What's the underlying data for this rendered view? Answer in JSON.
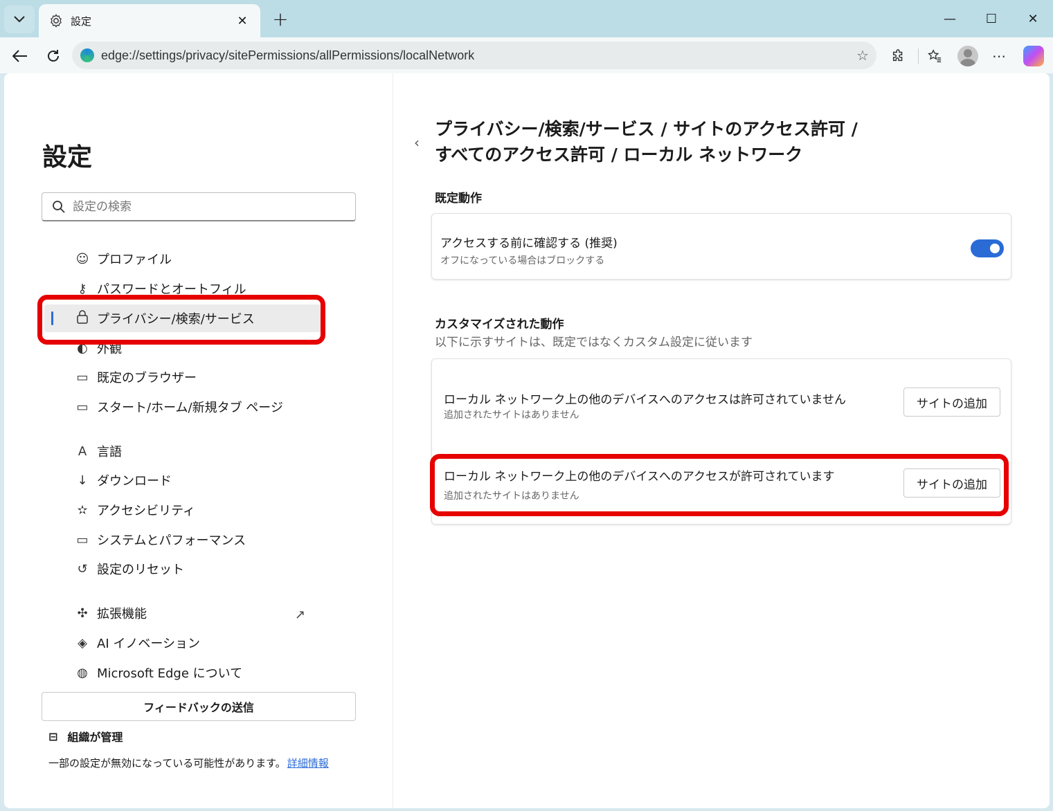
{
  "window": {
    "tab_title": "設定",
    "minimize": "—",
    "maximize": "☐",
    "close": "✕"
  },
  "toolbar": {
    "url": "edge://settings/privacy/sitePermissions/allPermissions/localNetwork"
  },
  "sidebar": {
    "title": "設定",
    "search_placeholder": "設定の検索",
    "items": [
      {
        "label": "プロファイル",
        "icon": "profile-icon"
      },
      {
        "label": "パスワードとオートフィル",
        "icon": "key-icon"
      },
      {
        "label": "プライバシー/検索/サービス",
        "icon": "lock-icon",
        "active": true
      },
      {
        "label": "外観",
        "icon": "palette-icon"
      },
      {
        "label": "既定のブラウザー",
        "icon": "browser-icon"
      },
      {
        "label": "スタート/ホーム/新規タブ ページ",
        "icon": "home-page-icon"
      },
      {
        "label": "言語",
        "icon": "language-icon"
      },
      {
        "label": "ダウンロード",
        "icon": "download-icon"
      },
      {
        "label": "アクセシビリティ",
        "icon": "accessibility-icon"
      },
      {
        "label": "システムとパフォーマンス",
        "icon": "laptop-icon"
      },
      {
        "label": "設定のリセット",
        "icon": "reset-icon"
      },
      {
        "label": "拡張機能",
        "icon": "puzzle-icon"
      },
      {
        "label": "AI イノベーション",
        "icon": "ai-icon"
      },
      {
        "label": "Microsoft Edge について",
        "icon": "edge-icon"
      }
    ],
    "feedback_label": "フィードバックの送信",
    "managed_label": "組織が管理",
    "managed_note": "一部の設定が無効になっている可能性があります。",
    "managed_link": "詳細情報"
  },
  "main": {
    "breadcrumb_line1": "プライバシー/検索/サービス / サイトのアクセス許可 /",
    "breadcrumb_line2": "すべてのアクセス許可 / ローカル ネットワーク",
    "default_section": "既定動作",
    "default_title": "アクセスする前に確認する (推奨)",
    "default_sub": "オフになっている場合はブロックする",
    "default_toggle_on": true,
    "custom_section": "カスタマイズされた動作",
    "custom_sub": "以下に示すサイトは、既定ではなくカスタム設定に従います",
    "block_title": "ローカル ネットワーク上の他のデバイスへのアクセスは許可されていません",
    "block_sub": "追加されたサイトはありません",
    "block_button": "サイトの追加",
    "allow_title": "ローカル ネットワーク上の他のデバイスへのアクセスが許可されています",
    "allow_sub": "追加されたサイトはありません",
    "allow_button": "サイトの追加"
  },
  "colors": {
    "accent": "#2a6bd6",
    "highlight": "#e60000"
  }
}
